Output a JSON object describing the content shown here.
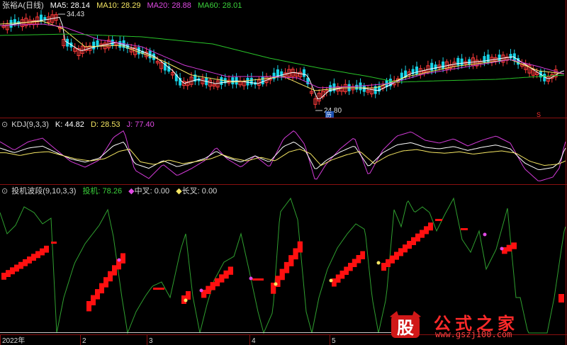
{
  "colors": {
    "background": "#000000",
    "up": "#ff3b3b",
    "down": "#18d4e8",
    "ma5": "#ffffff",
    "ma10": "#f5e663",
    "ma20": "#d13ad6",
    "ma60": "#28c228",
    "kdj_k": "#ffffff",
    "kdj_d": "#f5e663",
    "kdj_j": "#d13ad6",
    "panel_border": "#8a1010",
    "signal_bar": "#ff1010",
    "wave_line": "#2f9f2f"
  },
  "main": {
    "title": "张裕A(日线)",
    "ma5_label": "MA5: 28.14",
    "ma10_label": "MA10: 28.29",
    "ma20_label": "MA20: 28.88",
    "ma60_label": "MA60: 28.01",
    "high_label": "34.43",
    "low_label": "24.80",
    "low_badge": "历",
    "right_badge": "S"
  },
  "kdj": {
    "title": "KDJ(9,3,3)",
    "k_label": "K: 44.82",
    "d_label": "D: 28.53",
    "j_label": "J: 77.40"
  },
  "signal": {
    "title": "投机波段(9,10,3,3)",
    "tj_label": "投机: 78.26",
    "zc_label": "中叉: 0.00",
    "cc_label": "长叉: 0.00"
  },
  "x_axis": [
    "2022年",
    "2",
    "3",
    "4",
    "5"
  ],
  "watermark": {
    "text": "公式之家",
    "glyph": "股",
    "url": "www.gszj100.com"
  }
}
